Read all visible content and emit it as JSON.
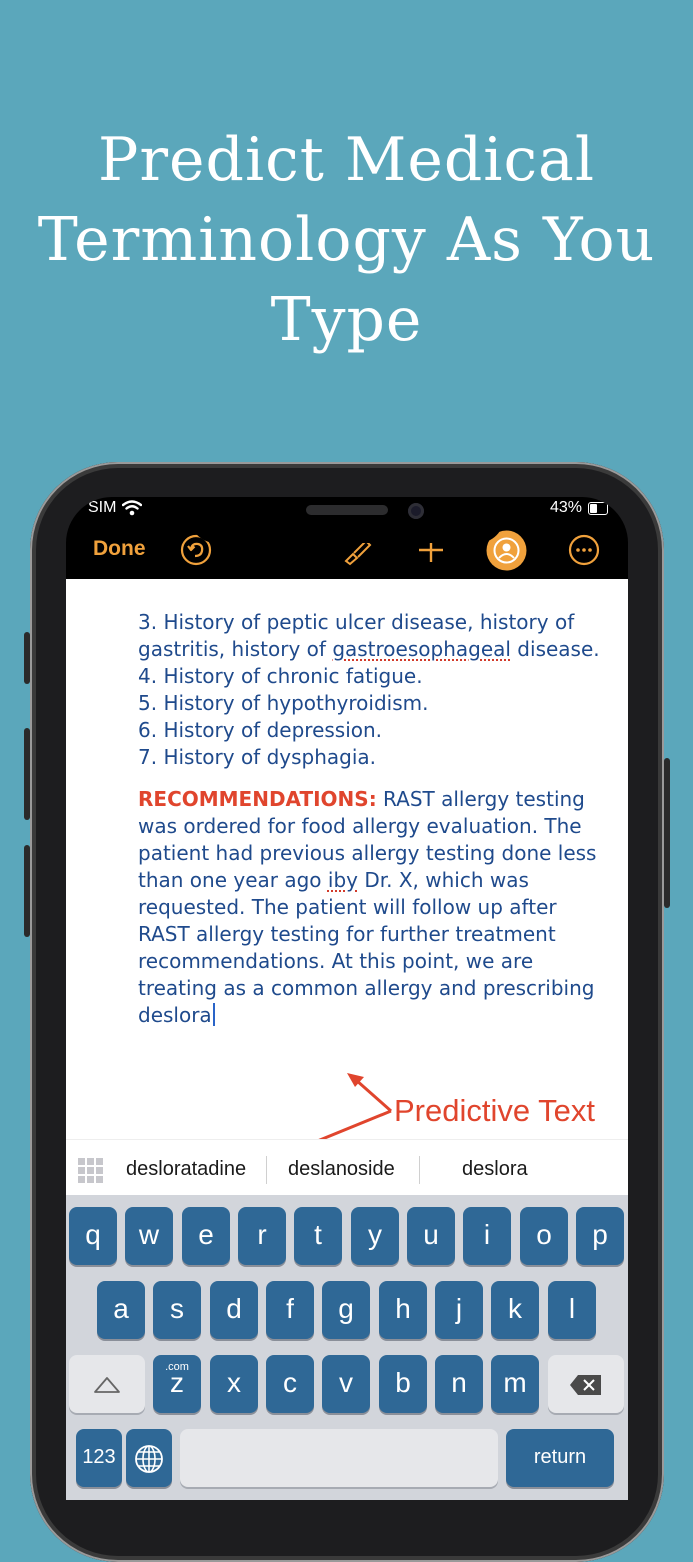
{
  "headline": [
    "Predict Medical",
    "Terminology As You",
    "Type"
  ],
  "status": {
    "carrier": "SIM",
    "battery": "43%"
  },
  "toolbar": {
    "done": "Done"
  },
  "document": {
    "history_items": [
      [
        "3. History of peptic ulcer disease, history of gastritis, history of ",
        "gastroesophageal",
        " disease."
      ],
      "4. History of chronic fatigue.",
      "5. History of hypothyroidism.",
      "6. History of depression.",
      "7. History of dysphagia."
    ],
    "rec_heading": "RECOMMENDATIONS:",
    "rec_part1": " RAST allergy testing was ordered for food allergy evaluation. The patient had previous allergy testing done less than one year ago ",
    "rec_squiggle": "iby",
    "rec_part2": " Dr. X, which was requested. The patient will follow up after RAST allergy testing for further treatment recommendations. At this point, we are treating as a common allergy and prescribing deslora"
  },
  "annotation": "Predictive Text",
  "suggestions": [
    "desloratadine",
    "deslanoside",
    "deslora"
  ],
  "keyboard": {
    "row1": [
      "q",
      "w",
      "e",
      "r",
      "t",
      "y",
      "u",
      "i",
      "o",
      "p"
    ],
    "row2": [
      "a",
      "s",
      "d",
      "f",
      "g",
      "h",
      "j",
      "k",
      "l"
    ],
    "row3": [
      "z",
      "x",
      "c",
      "v",
      "b",
      "n",
      "m"
    ],
    "com_hint": ".com",
    "numbers": "123",
    "return": "return"
  },
  "colors": {
    "background": "#5ba7bb",
    "accent": "#f0a13c",
    "text": "#1f4a8c",
    "highlight": "#e0452d",
    "key": "#2f6896"
  }
}
